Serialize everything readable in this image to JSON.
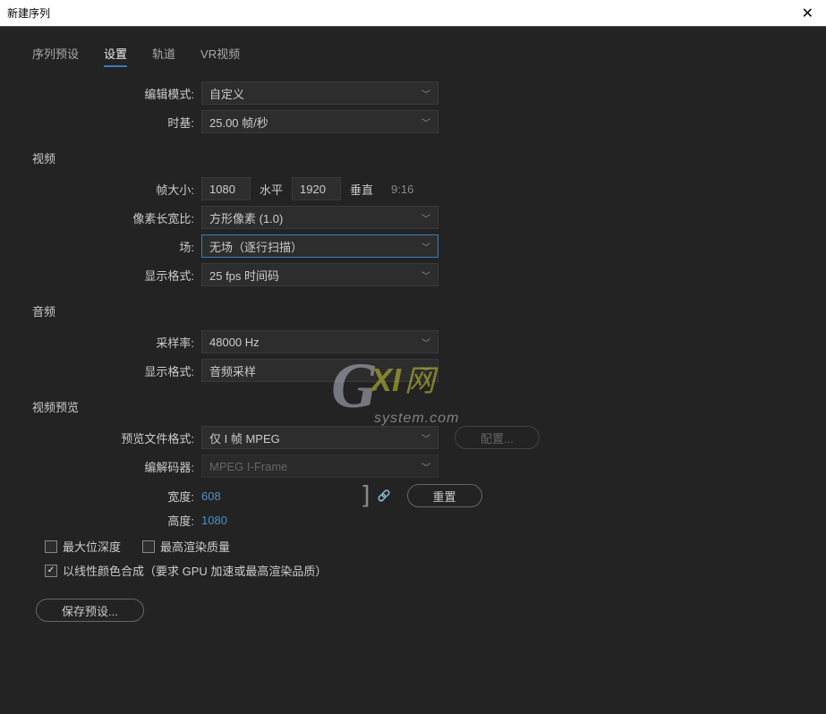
{
  "window": {
    "title": "新建序列"
  },
  "tabs": [
    {
      "id": "preset",
      "label": "序列预设"
    },
    {
      "id": "settings",
      "label": "设置"
    },
    {
      "id": "tracks",
      "label": "轨道"
    },
    {
      "id": "vr",
      "label": "VR视频"
    }
  ],
  "activeTab": "settings",
  "edit": {
    "mode_label": "编辑模式:",
    "mode_value": "自定义",
    "timebase_label": "时基:",
    "timebase_value": "25.00 帧/秒"
  },
  "video": {
    "header": "视频",
    "frame_size_label": "帧大小:",
    "width": "1080",
    "h_label": "水平",
    "height": "1920",
    "v_label": "垂直",
    "ratio": "9:16",
    "par_label": "像素长宽比:",
    "par_value": "方形像素 (1.0)",
    "fields_label": "场:",
    "fields_value": "无场（逐行扫描）",
    "display_format_label": "显示格式:",
    "display_format_value": "25 fps 时间码"
  },
  "audio": {
    "header": "音频",
    "sample_rate_label": "采样率:",
    "sample_rate_value": "48000 Hz",
    "display_format_label": "显示格式:",
    "display_format_value": "音频采样"
  },
  "preview": {
    "header": "视频预览",
    "file_format_label": "预览文件格式:",
    "file_format_value": "仅 I 帧 MPEG",
    "configure_label": "配置...",
    "codec_label": "编解码器:",
    "codec_value": "MPEG I-Frame",
    "width_label": "宽度:",
    "width_value": "608",
    "height_label": "高度:",
    "height_value": "1080",
    "reset_label": "重置"
  },
  "checks": {
    "max_bit_depth": "最大位深度",
    "max_render_quality": "最高渲染质量",
    "linear_composite": "以线性颜色合成（要求 GPU 加速或最高渲染品质）"
  },
  "save_preset_label": "保存预设...",
  "watermark": {
    "g": "G",
    "xi": "XI",
    "cn": "网",
    "sys": "system.com"
  }
}
